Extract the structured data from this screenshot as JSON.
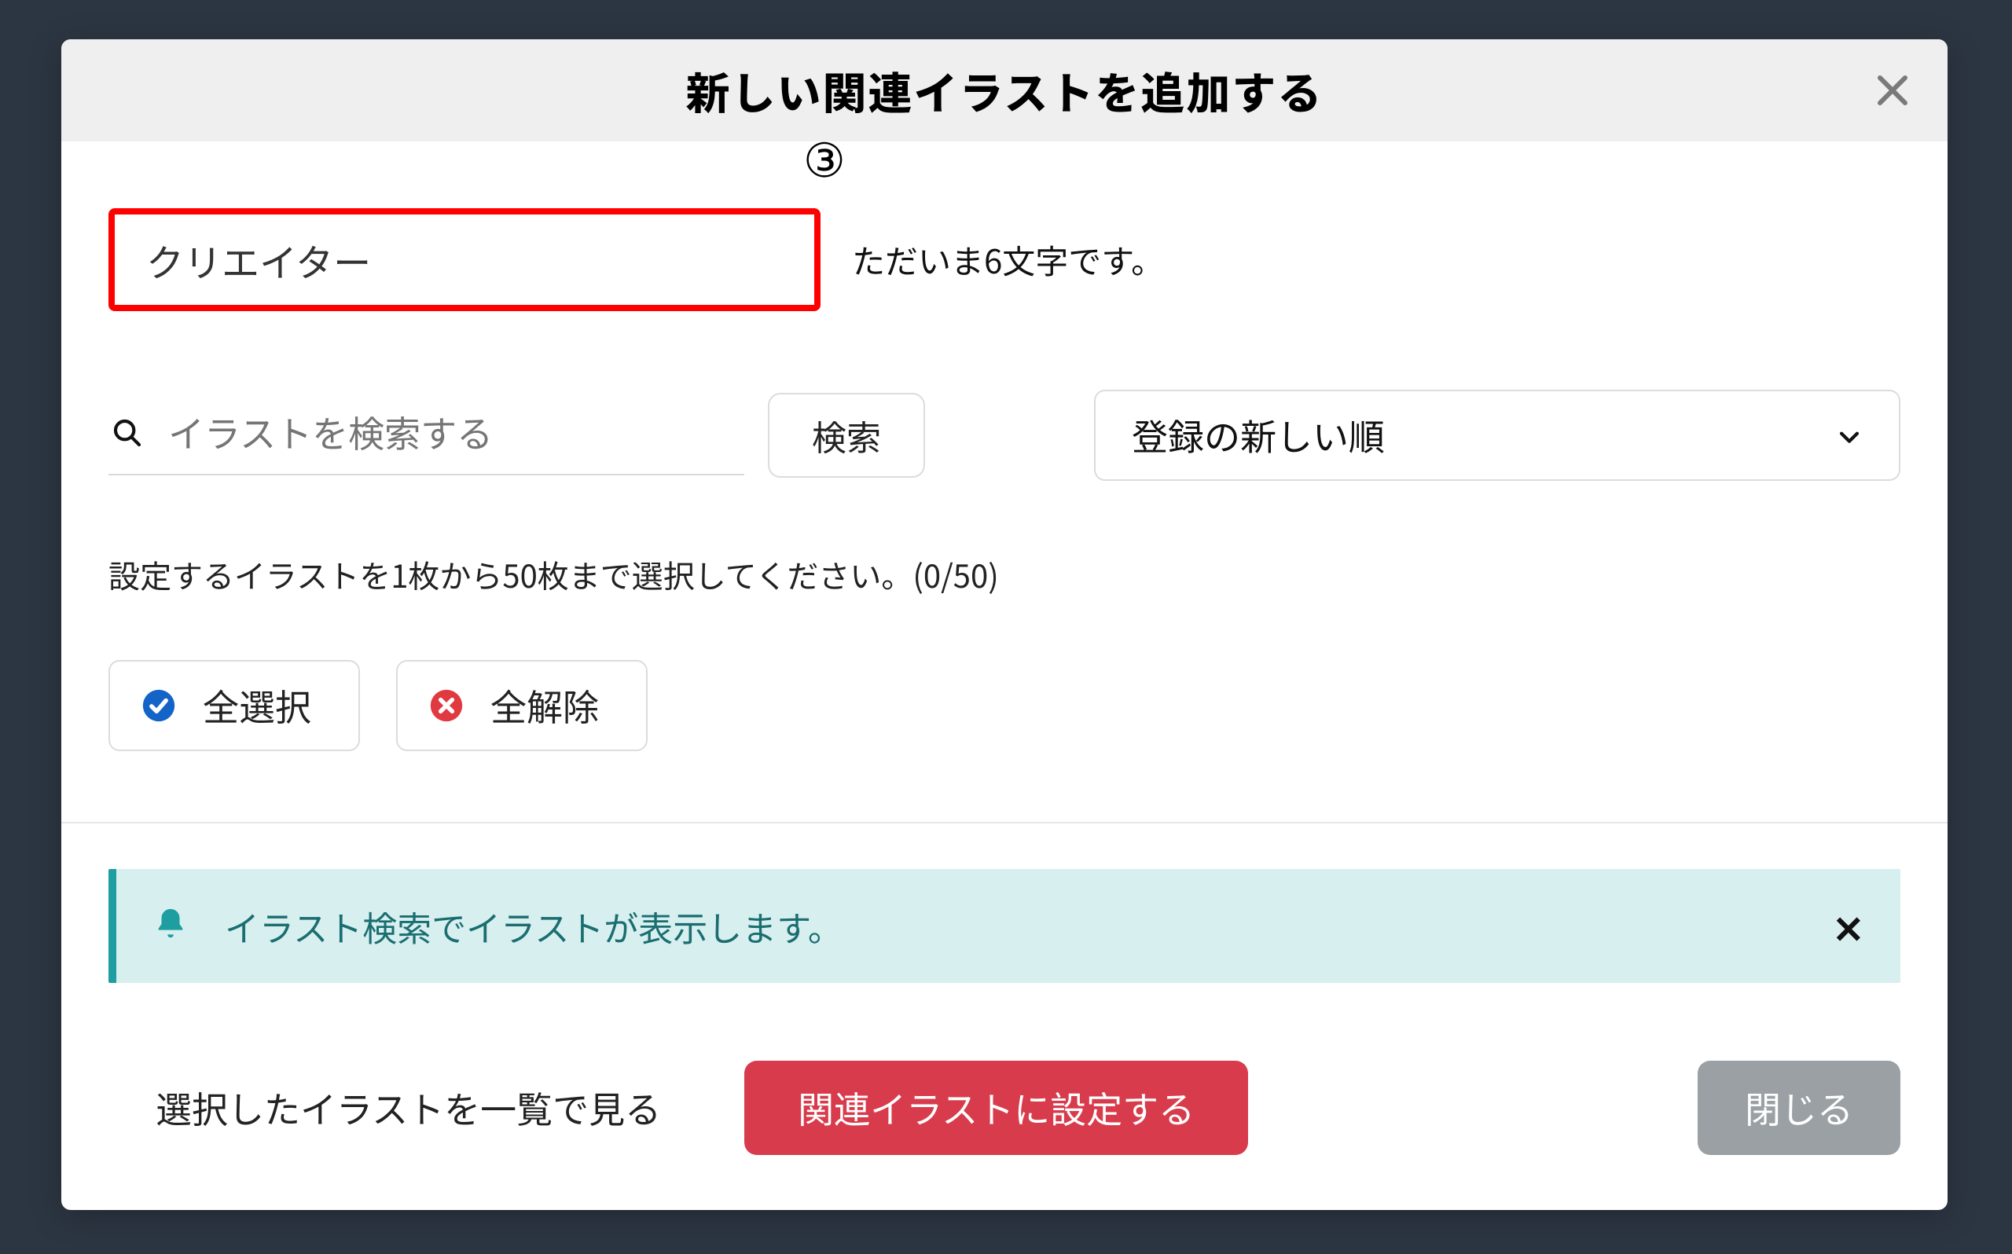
{
  "dialog": {
    "title": "新しい関連イラストを追加する",
    "step_marker": "③"
  },
  "tag": {
    "value": "クリエイター",
    "char_count_text": "ただいま6文字です。"
  },
  "search": {
    "placeholder": "イラストを検索する",
    "button": "検索"
  },
  "sort": {
    "selected": "登録の新しい順"
  },
  "instruction_text": "設定するイラストを1枚から50枚まで選択してください。(0/50)",
  "selection": {
    "select_all": "全選択",
    "deselect_all": "全解除"
  },
  "info": {
    "message": "イラスト検索でイラストが表示します。"
  },
  "footer": {
    "view_selected": "選択したイラストを一覧で見る",
    "apply": "関連イラストに設定する",
    "close": "閉じる"
  }
}
